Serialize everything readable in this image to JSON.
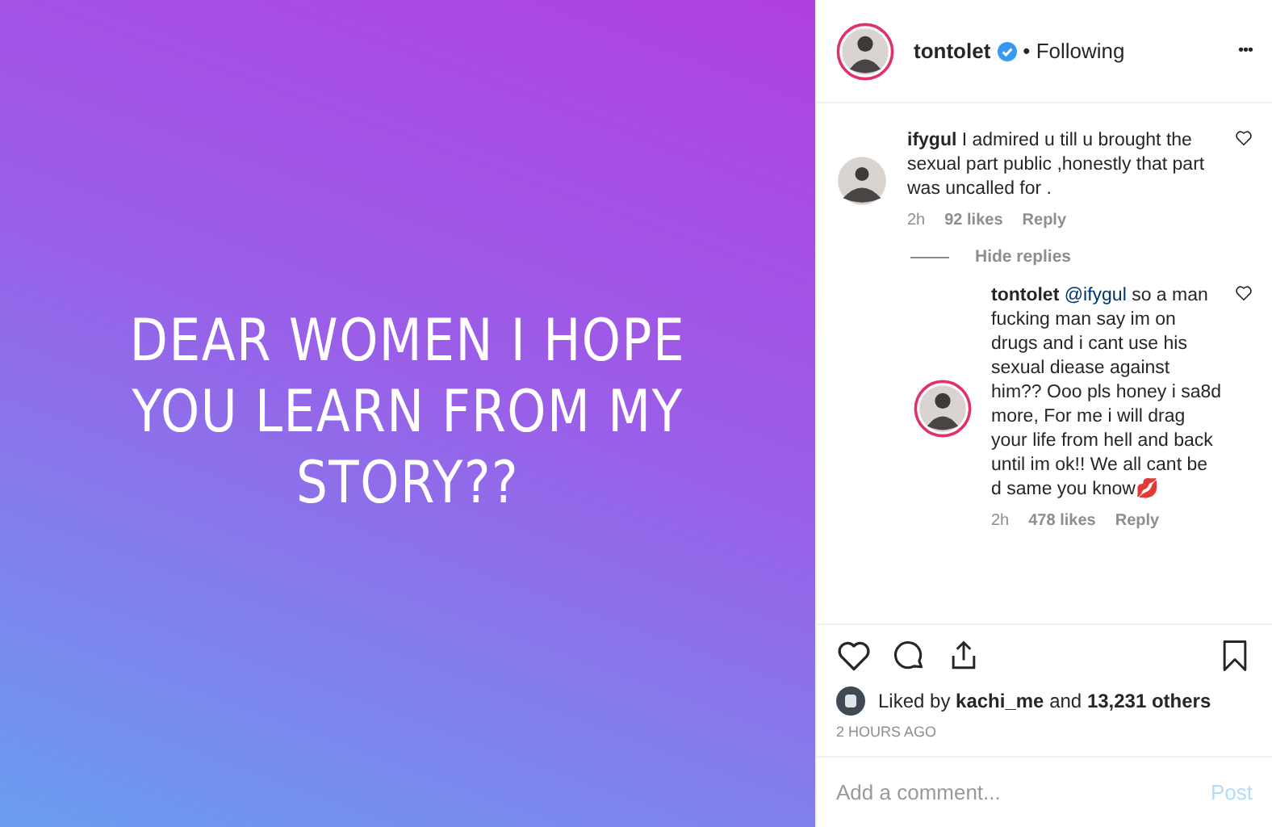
{
  "post_image": {
    "caption": "DEAR WOMEN I HOPE YOU LEARN FROM MY STORY??"
  },
  "header": {
    "username": "tontolet",
    "verified": true,
    "separator": "•",
    "follow_status": "Following",
    "more": "•••"
  },
  "comments": [
    {
      "username": "ifygul",
      "text": "I admired u till u brought the sexual part public ,honestly that part was uncalled for .",
      "time": "2h",
      "likes": "92 likes",
      "reply": "Reply",
      "liked": false,
      "reply_level": false
    },
    {
      "username": "tontolet",
      "mention": "@ifygul",
      "text": "so a man fucking man say im on drugs and i cant use his sexual diease against him?? Ooo pls honey i sa8d more, For me i will drag your life from hell and back until im ok!! We all cant be d same you know💋",
      "time": "2h",
      "likes": "478 likes",
      "reply": "Reply",
      "liked": false,
      "reply_level": true
    }
  ],
  "hide_replies": "Hide replies",
  "actions": {
    "liked": false,
    "saved": false
  },
  "likes_line": "Liked by **kachi_me** and **13,231 others**",
  "timestamp": "2 HOURS AGO",
  "comment_field": {
    "placeholder": "Add a comment...",
    "post": "Post"
  }
}
